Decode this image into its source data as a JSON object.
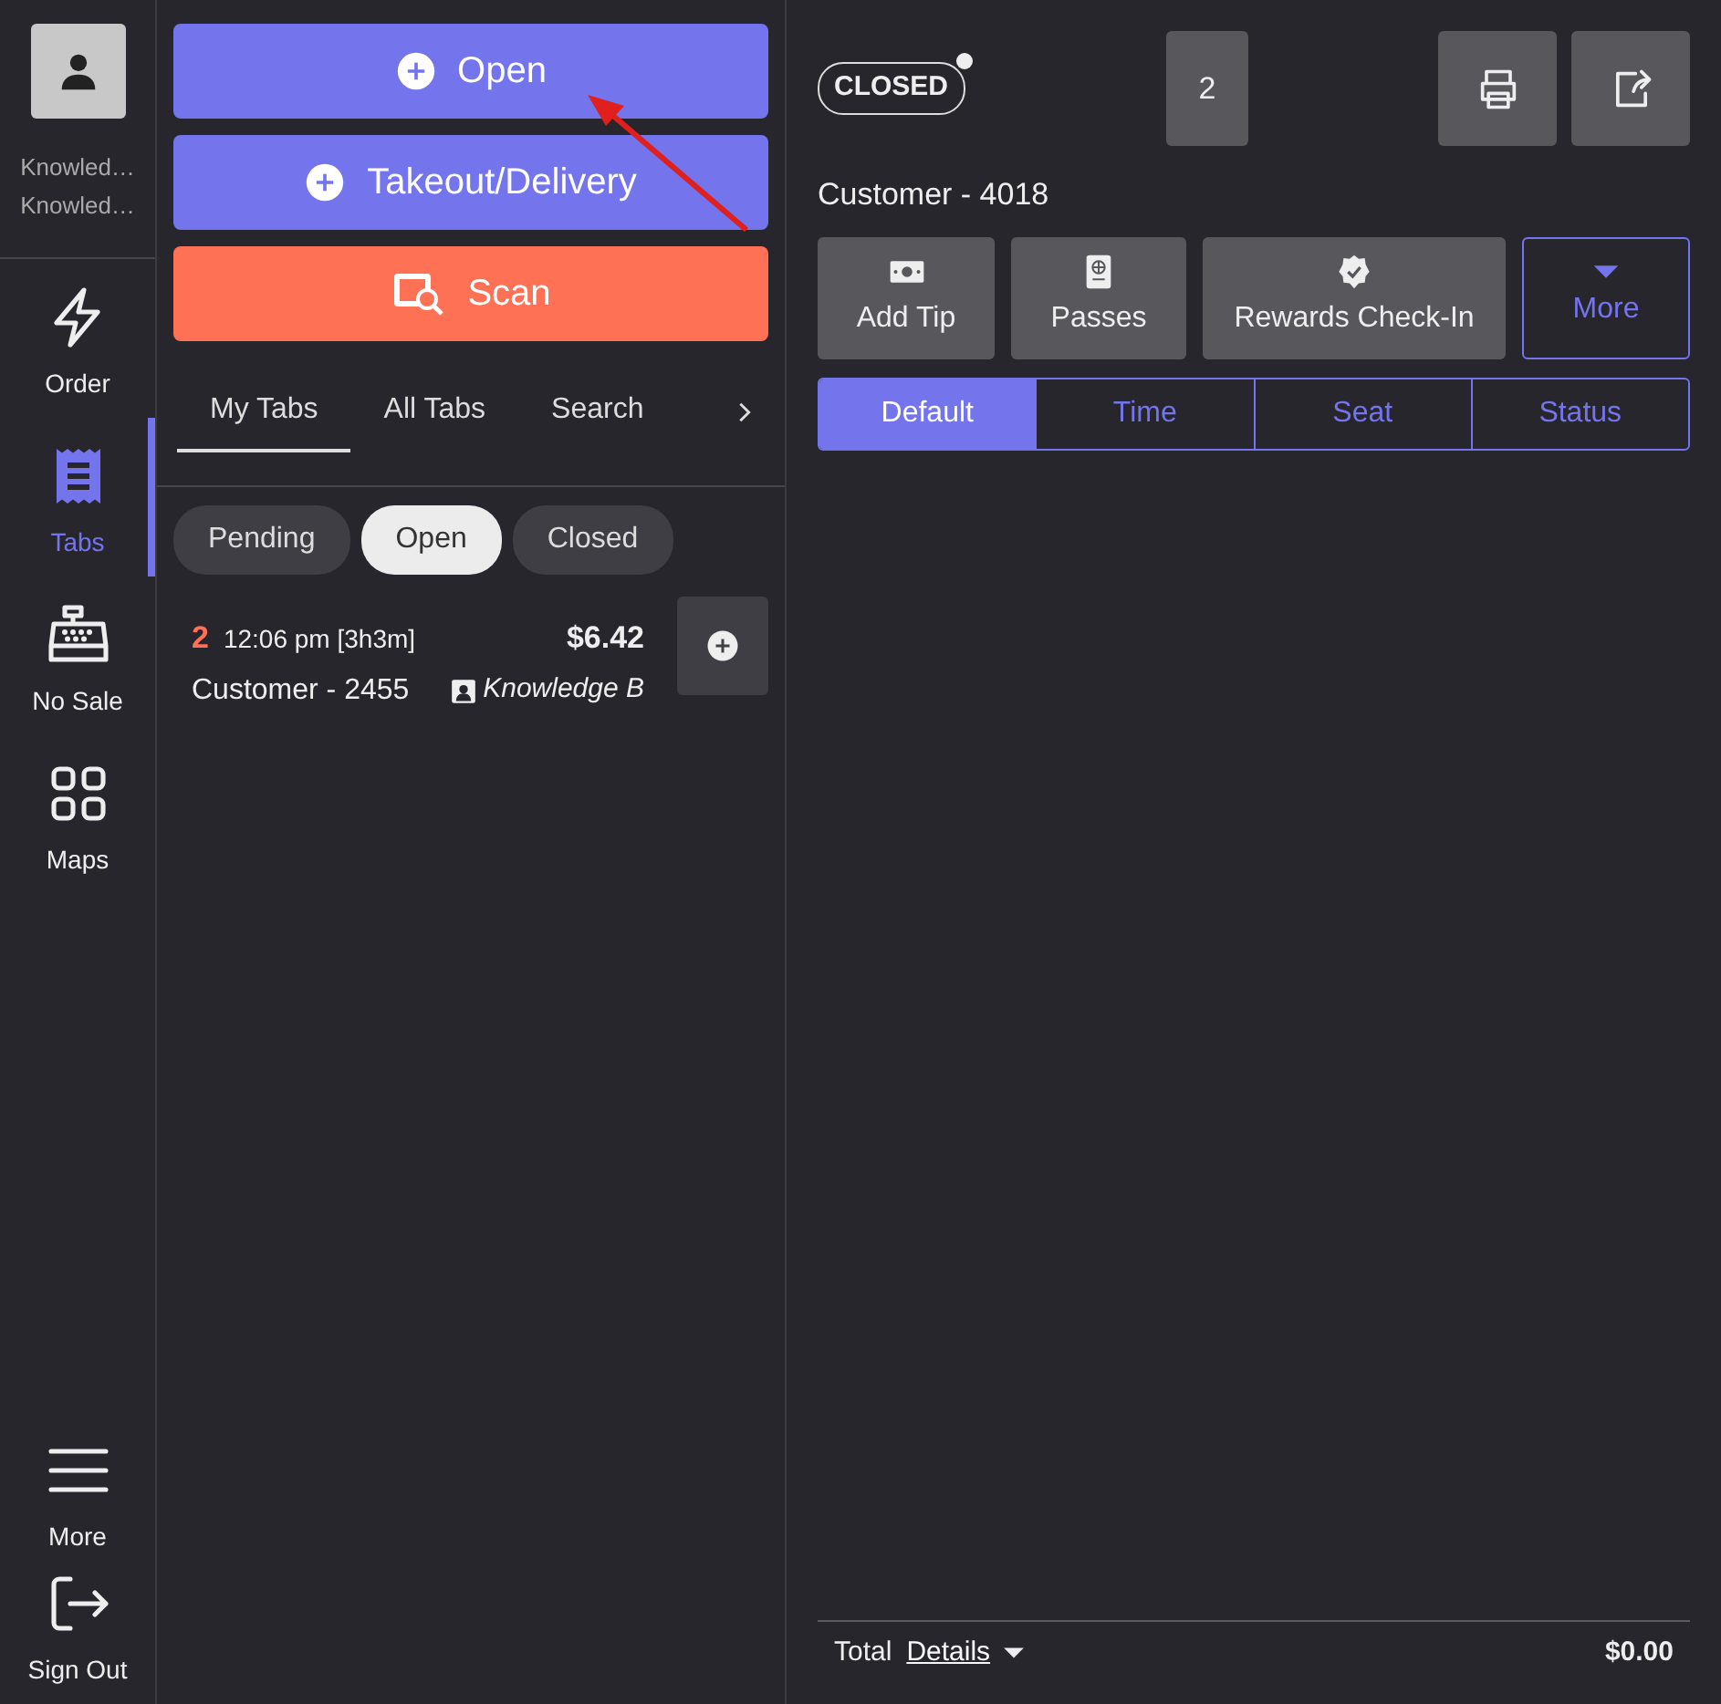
{
  "user": {
    "lines": [
      "Knowled…",
      "Knowled…"
    ]
  },
  "nav": [
    {
      "label": "Order",
      "kind": "bolt",
      "selected": false
    },
    {
      "label": "Tabs",
      "kind": "receipt",
      "selected": true
    },
    {
      "label": "No Sale",
      "kind": "register",
      "selected": false
    },
    {
      "label": "Maps",
      "kind": "grid",
      "selected": false
    }
  ],
  "nav_bottom": [
    {
      "label": "More",
      "kind": "menu"
    },
    {
      "label": "Sign Out",
      "kind": "signout"
    }
  ],
  "actions": [
    {
      "label": "Open",
      "kind": "plus"
    },
    {
      "label": "Takeout/Delivery",
      "kind": "plus"
    },
    {
      "label": "Scan",
      "kind": "scan"
    }
  ],
  "tabs": [
    {
      "label": "My Tabs",
      "selected": true
    },
    {
      "label": "All Tabs",
      "selected": false
    },
    {
      "label": "Search",
      "selected": false
    }
  ],
  "filters": [
    {
      "label": "Pending",
      "selected": false
    },
    {
      "label": "Open",
      "selected": true
    },
    {
      "label": "Closed",
      "selected": false
    }
  ],
  "tickets": [
    {
      "count": "2",
      "time": "12:06 pm [3h3m]",
      "amount": "$6.42",
      "customer": "Customer - 2455",
      "server": "Knowledge B"
    }
  ],
  "order": {
    "status": "CLOSED",
    "guests": "2",
    "customer": "Customer - 4018",
    "quick_actions": [
      {
        "label": "Add Tip",
        "kind": "cash"
      },
      {
        "label": "Passes",
        "kind": "passport"
      },
      {
        "label": "Rewards Check-In",
        "kind": "badge"
      }
    ],
    "more": "More",
    "sort": [
      {
        "label": "Default",
        "selected": true
      },
      {
        "label": "Time",
        "selected": false
      },
      {
        "label": "Seat",
        "selected": false
      },
      {
        "label": "Status",
        "selected": false
      }
    ],
    "total_label": "Total",
    "details": "Details",
    "total": "$0.00"
  }
}
